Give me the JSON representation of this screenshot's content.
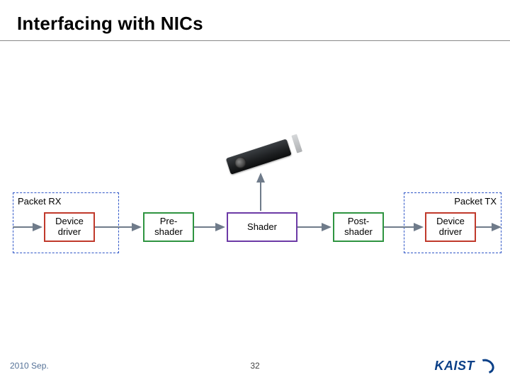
{
  "title": "Interfacing with NICs",
  "rx_label": "Packet RX",
  "tx_label": "Packet TX",
  "stages": {
    "device_rx": "Device\ndriver",
    "pre_shader": "Pre-\nshader",
    "shader": "Shader",
    "post_shader": "Post-\nshader",
    "device_tx": "Device\ndriver"
  },
  "footer": {
    "date": "2010 Sep.",
    "page": "32",
    "logo": "KAIST"
  },
  "colors": {
    "dashed_border": "#2f56c7",
    "red": "#c0392b",
    "green": "#2e9440",
    "purple": "#6c3aa6",
    "arrow": "#6f7b8a",
    "logo": "#0a3f87"
  }
}
